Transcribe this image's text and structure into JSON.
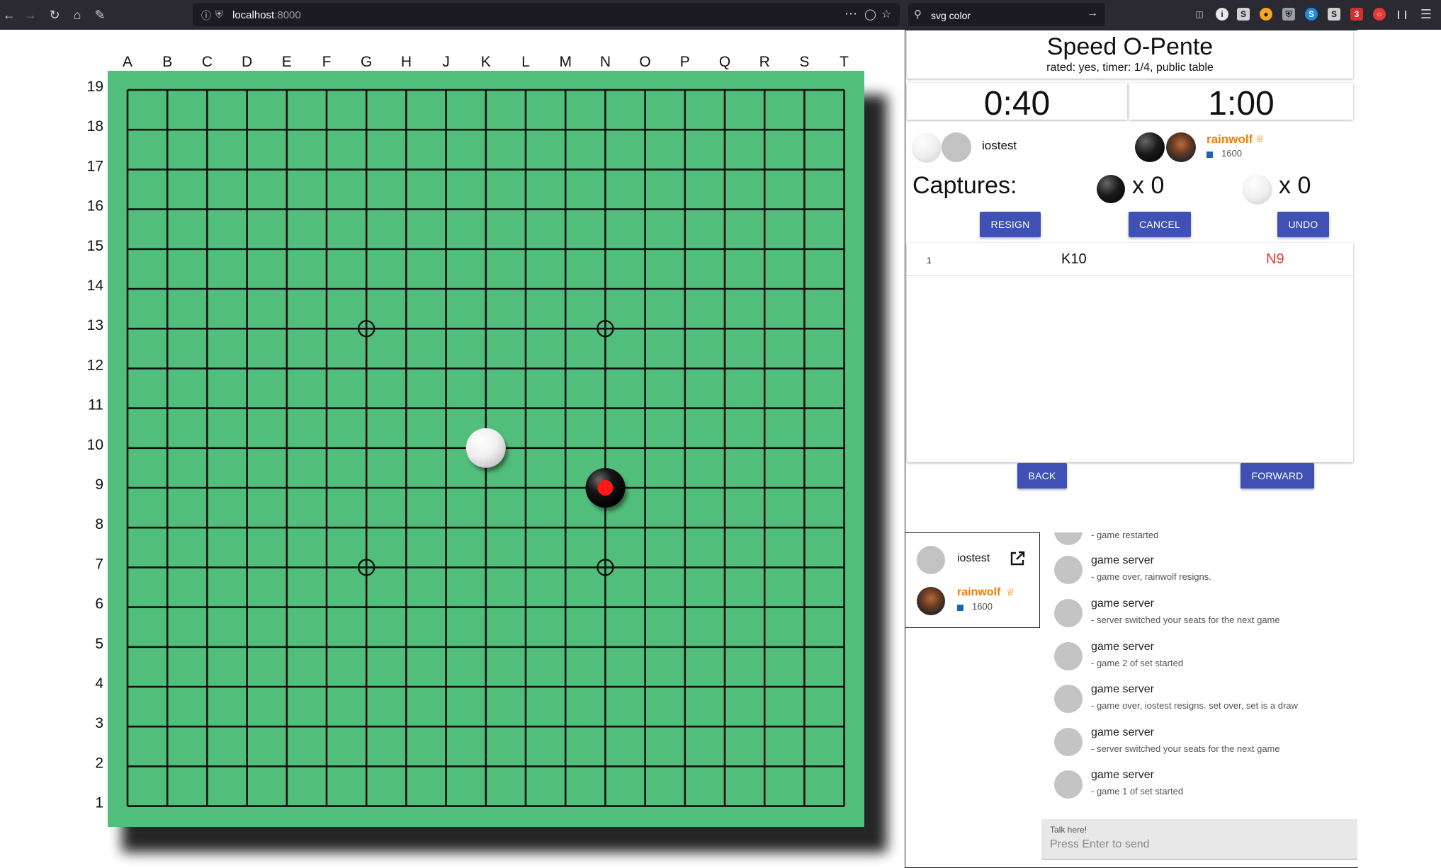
{
  "browser": {
    "url_host": "localhost",
    "url_port": ":8000",
    "search_query": "svg color"
  },
  "board": {
    "columns": [
      "A",
      "B",
      "C",
      "D",
      "E",
      "F",
      "G",
      "H",
      "J",
      "K",
      "L",
      "M",
      "N",
      "O",
      "P",
      "Q",
      "R",
      "S",
      "T"
    ],
    "rows": [
      "19",
      "18",
      "17",
      "16",
      "15",
      "14",
      "13",
      "12",
      "11",
      "10",
      "9",
      "8",
      "7",
      "6",
      "5",
      "4",
      "3",
      "2",
      "1"
    ],
    "board_color": "#52be7b",
    "grid_color": "#111111",
    "hoshi": [
      "G13",
      "N13",
      "G7",
      "N7"
    ],
    "stones": [
      {
        "point": "K10",
        "color": "white"
      },
      {
        "point": "N9",
        "color": "black",
        "last_move": true
      }
    ]
  },
  "game": {
    "title": "Speed O-Pente",
    "subtitle": "rated: yes, timer: 1/4, public table"
  },
  "timers": {
    "left": "0:40",
    "right": "1:00"
  },
  "players": {
    "white": {
      "name": "iostest"
    },
    "black": {
      "name": "rainwolf",
      "rating": "1600"
    }
  },
  "captures": {
    "label": "Captures:",
    "black_count": "x 0",
    "white_count": "x 0"
  },
  "buttons": {
    "resign": "RESIGN",
    "cancel": "CANCEL",
    "undo": "UNDO",
    "back": "BACK",
    "forward": "FORWARD"
  },
  "moves": [
    {
      "num": "1",
      "white": "K10",
      "black": "N9"
    }
  ],
  "table_players": [
    {
      "name": "iostest"
    },
    {
      "name": "rainwolf",
      "rating": "1600"
    }
  ],
  "chat": {
    "partial_top": "- game restarted",
    "messages": [
      {
        "who": "game server",
        "text": "- game over, rainwolf resigns."
      },
      {
        "who": "game server",
        "text": "- server switched your seats for the next game"
      },
      {
        "who": "game server",
        "text": "- game 2 of set started"
      },
      {
        "who": "game server",
        "text": "- game over, iostest resigns. set over, set is a draw"
      },
      {
        "who": "game server",
        "text": "- server switched your seats for the next game"
      },
      {
        "who": "game server",
        "text": "- game 1 of set started"
      }
    ],
    "input_label": "Talk here!",
    "input_placeholder": "Press Enter to send"
  }
}
